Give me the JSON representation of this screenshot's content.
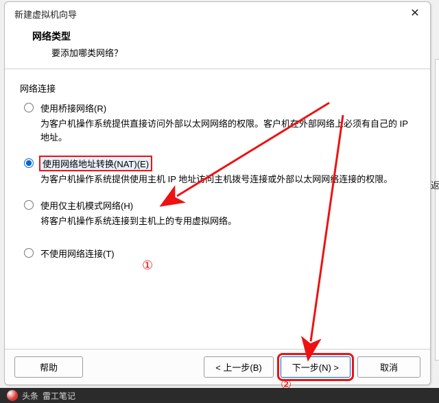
{
  "window": {
    "title": "新建虚拟机向导"
  },
  "header": {
    "title": "网络类型",
    "subtitle": "要添加哪类网络？"
  },
  "group": {
    "label": "网络连接"
  },
  "options": {
    "bridged": {
      "label": "使用桥接网络(R)",
      "desc": "为客户机操作系统提供直接访问外部以太网网络的权限。客户机在外部网络上必须有自己的 IP 地址。"
    },
    "nat": {
      "label": "使用网络地址转换(NAT)(E)",
      "desc": "为客户机操作系统提供使用主机 IP 地址访问主机拨号连接或外部以太网网络连接的权限。"
    },
    "hostonly": {
      "label": "使用仅主机模式网络(H)",
      "desc": "将客户机操作系统连接到主机上的专用虚拟网络。"
    },
    "none": {
      "label": "不使用网络连接(T)"
    }
  },
  "buttons": {
    "help": "帮助",
    "back": "< 上一步(B)",
    "next": "下一步(N) >",
    "cancel": "取消"
  },
  "annotations": {
    "one": "①",
    "two": "②"
  },
  "side": {
    "ret": "返"
  },
  "footer": {
    "prefix": "头条",
    "author": "雷工笔记"
  }
}
